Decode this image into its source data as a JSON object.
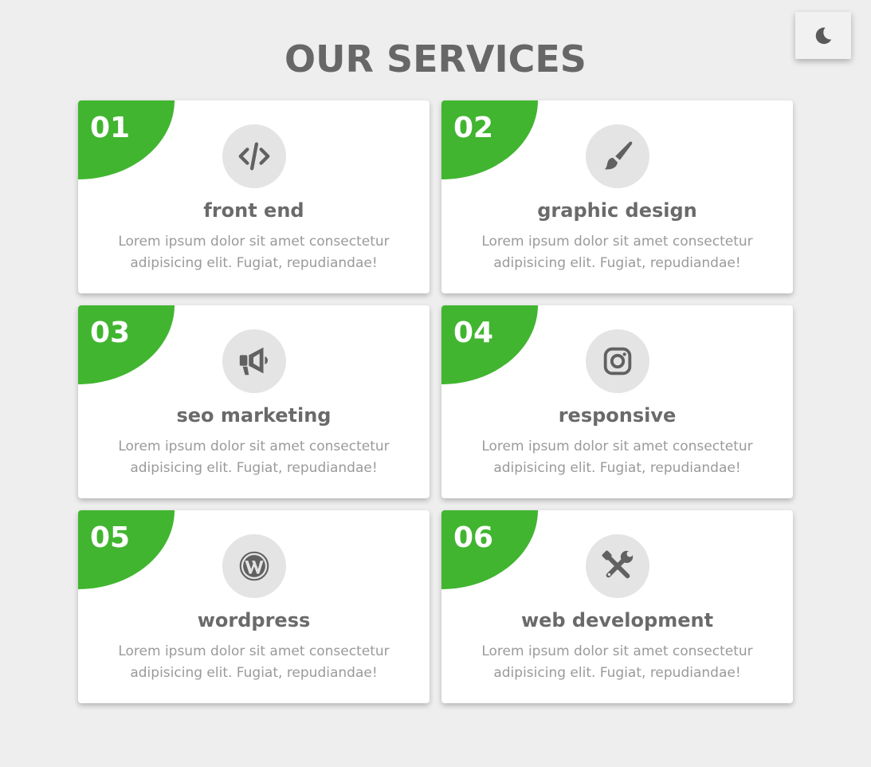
{
  "theme_toggle": {
    "icon": "moon-icon"
  },
  "header": {
    "title": "OUR SERVICES"
  },
  "colors": {
    "accent": "#41b530",
    "background": "#eeeeee",
    "card": "#ffffff",
    "icon_bg": "#e4e4e4",
    "icon": "#616161",
    "title": "#676767",
    "text": "#9a9a9a"
  },
  "services": [
    {
      "number": "01",
      "title": "front end",
      "description": "Lorem ipsum dolor sit amet consectetur adipisicing elit. Fugiat, repudiandae!",
      "icon": "code-icon"
    },
    {
      "number": "02",
      "title": "graphic design",
      "description": "Lorem ipsum dolor sit amet consectetur adipisicing elit. Fugiat, repudiandae!",
      "icon": "paintbrush-icon"
    },
    {
      "number": "03",
      "title": "seo marketing",
      "description": "Lorem ipsum dolor sit amet consectetur adipisicing elit. Fugiat, repudiandae!",
      "icon": "megaphone-icon"
    },
    {
      "number": "04",
      "title": "responsive",
      "description": "Lorem ipsum dolor sit amet consectetur adipisicing elit. Fugiat, repudiandae!",
      "icon": "instagram-icon"
    },
    {
      "number": "05",
      "title": "wordpress",
      "description": "Lorem ipsum dolor sit amet consectetur adipisicing elit. Fugiat, repudiandae!",
      "icon": "wordpress-icon"
    },
    {
      "number": "06",
      "title": "web development",
      "description": "Lorem ipsum dolor sit amet consectetur adipisicing elit. Fugiat, repudiandae!",
      "icon": "tools-icon"
    }
  ]
}
